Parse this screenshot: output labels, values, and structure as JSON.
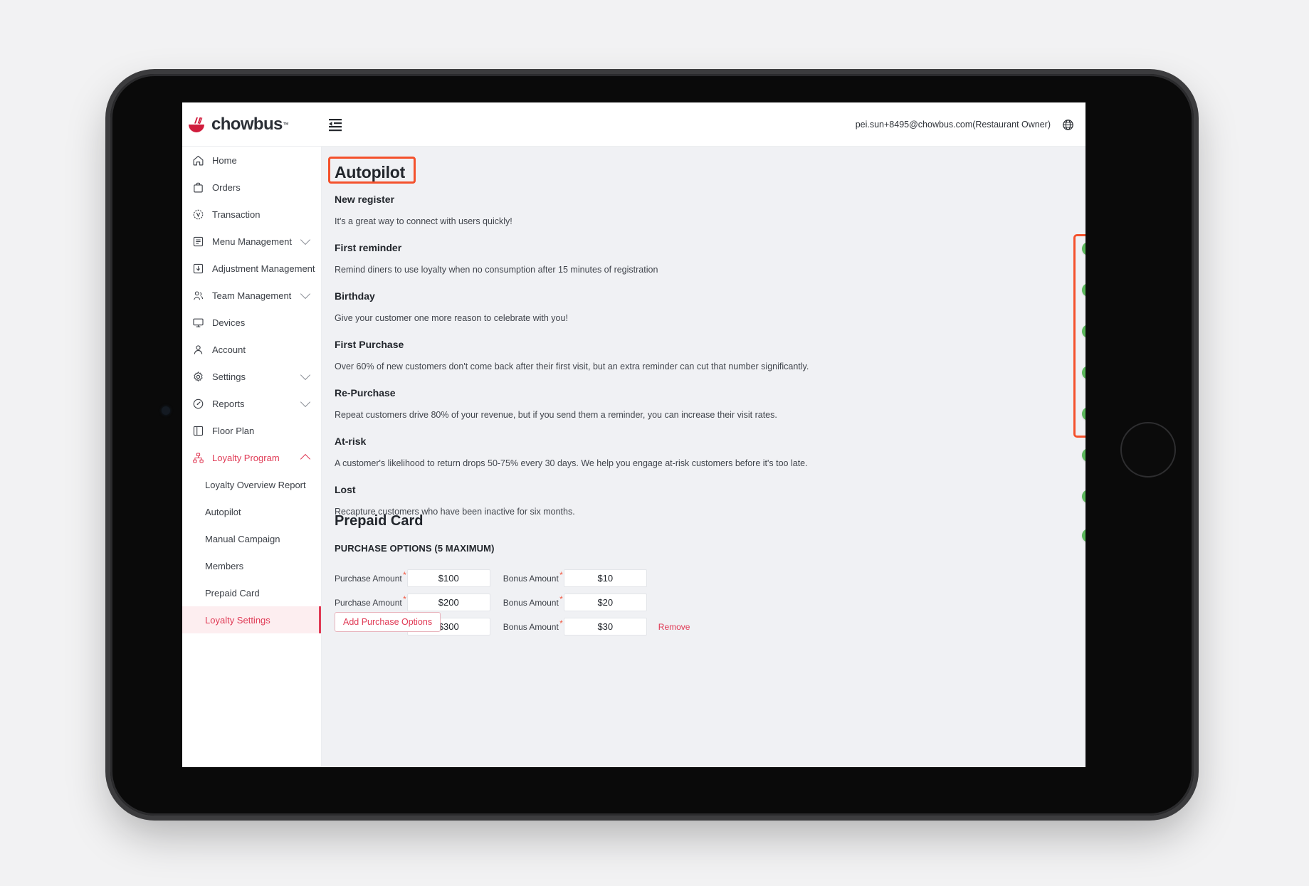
{
  "app": {
    "logo_text": "chowbus",
    "logo_tm": "™",
    "logo_icon": "chowbus-bowl-icon"
  },
  "topbar": {
    "collapse_icon": "menu-fold-icon",
    "account_email": "pei.sun+8495@chowbus.com(Restaurant Owner)",
    "language_icon": "globe-icon"
  },
  "sidebar": {
    "items": [
      {
        "label": "Home",
        "icon": "home-icon",
        "expandable": false,
        "active": false
      },
      {
        "label": "Orders",
        "icon": "bag-icon",
        "expandable": false,
        "active": false
      },
      {
        "label": "Transaction",
        "icon": "transaction-icon",
        "expandable": false,
        "active": false
      },
      {
        "label": "Menu Management",
        "icon": "menu-list-icon",
        "expandable": true,
        "expanded": false,
        "active": false
      },
      {
        "label": "Adjustment Management",
        "icon": "adjustment-icon",
        "expandable": false,
        "active": false
      },
      {
        "label": "Team Management",
        "icon": "team-icon",
        "expandable": true,
        "expanded": false,
        "active": false
      },
      {
        "label": "Devices",
        "icon": "monitor-icon",
        "expandable": false,
        "active": false
      },
      {
        "label": "Account",
        "icon": "user-icon",
        "expandable": false,
        "active": false
      },
      {
        "label": "Settings",
        "icon": "gear-icon",
        "expandable": true,
        "expanded": false,
        "active": false
      },
      {
        "label": "Reports",
        "icon": "gauge-icon",
        "expandable": true,
        "expanded": false,
        "active": false
      },
      {
        "label": "Floor Plan",
        "icon": "floorplan-icon",
        "expandable": false,
        "active": false
      },
      {
        "label": "Loyalty Program",
        "icon": "loyalty-icon",
        "expandable": true,
        "expanded": true,
        "active": true
      }
    ],
    "sub_items": [
      {
        "label": "Loyalty Overview Report",
        "selected": false
      },
      {
        "label": "Autopilot",
        "selected": false
      },
      {
        "label": "Manual Campaign",
        "selected": false
      },
      {
        "label": "Members",
        "selected": false
      },
      {
        "label": "Prepaid Card",
        "selected": false
      },
      {
        "label": "Loyalty Settings",
        "selected": true
      }
    ]
  },
  "main": {
    "page_title": "Autopilot",
    "autopilot_sections": [
      {
        "title": "New register",
        "description": "It's a great way to connect with users quickly!",
        "toggle_on": true
      },
      {
        "title": "First reminder",
        "description": "Remind diners to use loyalty when no consumption after 15 minutes of registration",
        "toggle_on": true
      },
      {
        "title": "Birthday",
        "description": "Give your customer one more reason to celebrate with you!",
        "toggle_on": true
      },
      {
        "title": "First Purchase",
        "description": "Over 60% of new customers don't come back after their first visit, but an extra reminder can cut that number significantly.",
        "toggle_on": true
      },
      {
        "title": "Re-Purchase",
        "description": "Repeat customers drive 80% of your revenue, but if you send them a reminder, you can increase their visit rates.",
        "toggle_on": true
      },
      {
        "title": "At-risk",
        "description": "A customer's likelihood to return drops 50-75% every 30 days. We help you engage at-risk customers before it's too late.",
        "toggle_on": true
      },
      {
        "title": "Lost",
        "description": "Recapture customers who have been inactive for six months.",
        "toggle_on": true
      }
    ],
    "extra_toggle_on": true,
    "prepaid": {
      "title": "Prepaid Card",
      "options_label": "PURCHASE OPTIONS (5 MAXIMUM)",
      "purchase_label": "Purchase Amount",
      "bonus_label": "Bonus Amount",
      "required_mark": "*",
      "rows": [
        {
          "purchase": "$100",
          "bonus": "$10",
          "remove": ""
        },
        {
          "purchase": "$200",
          "bonus": "$20",
          "remove": ""
        },
        {
          "purchase": "$300",
          "bonus": "$30",
          "remove": "Remove"
        }
      ],
      "add_button": "Add Purchase Options"
    }
  },
  "annotations": {
    "title_box_color": "#f4512c",
    "toggle_box_color": "#f4512c"
  },
  "colors": {
    "brand_red": "#e03a55",
    "toggle_green": "#5cb85c",
    "content_bg": "#f0f1f4",
    "sidebar_bg": "#ffffff"
  }
}
